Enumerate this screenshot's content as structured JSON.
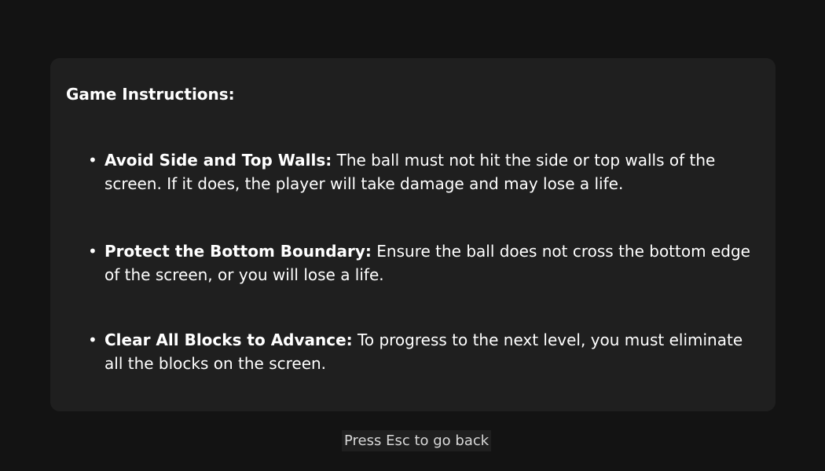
{
  "instructions": {
    "title": "Game Instructions:",
    "rules": [
      {
        "heading": "Avoid Side and Top Walls:",
        "text": " The ball must not hit the side or top walls of the screen. If it does, the player will take damage and may lose a life."
      },
      {
        "heading": "Protect the Bottom Boundary:",
        "text": " Ensure the ball does not cross the bottom edge of the screen, or you will lose a life."
      },
      {
        "heading": "Clear All Blocks to Advance:",
        "text": " To progress to the next level, you must eliminate all the blocks on the screen."
      }
    ]
  },
  "footer": {
    "hint": "Press Esc to go back"
  },
  "colors": {
    "background": "#131313",
    "panel": "#1f1f1f",
    "text": "#ffffff",
    "hint_text": "#d8d8d8"
  }
}
